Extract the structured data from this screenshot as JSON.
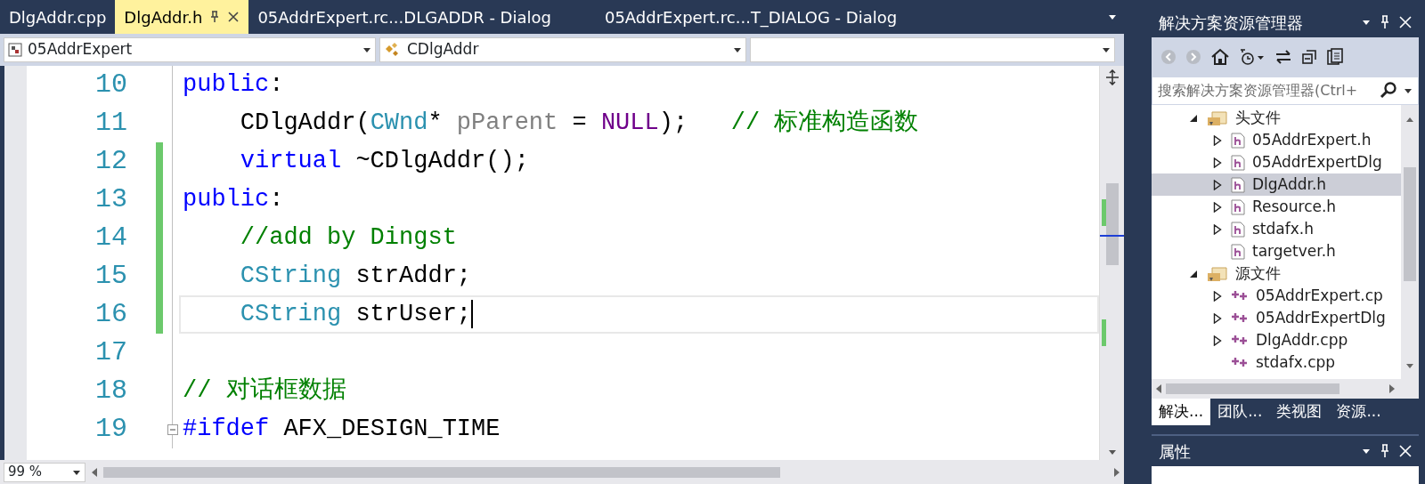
{
  "editor_tabs": [
    {
      "label": "DlgAddr.cpp",
      "selected": false,
      "pinned": false
    },
    {
      "label": "DlgAddr.h",
      "selected": true,
      "pinned": true
    },
    {
      "label": "05AddrExpert.rc...DLGADDR - Dialog",
      "selected": false,
      "pinned": false
    },
    {
      "label": "05AddrExpert.rc...T_DIALOG - Dialog",
      "selected": false,
      "pinned": false
    }
  ],
  "nav_bar": {
    "project": "05AddrExpert",
    "class": "CDlgAddr"
  },
  "code": {
    "lines": [
      {
        "number": "10",
        "indented": false,
        "modified": false,
        "current": false,
        "tokens": [
          {
            "kind": "keyword",
            "text": "public"
          },
          {
            "kind": "plain",
            "text": ":"
          }
        ]
      },
      {
        "number": "11",
        "indented": true,
        "modified": false,
        "current": false,
        "tokens": [
          {
            "kind": "plain",
            "text": "CDlgAddr("
          },
          {
            "kind": "type",
            "text": "CWnd"
          },
          {
            "kind": "plain",
            "text": "* "
          },
          {
            "kind": "param",
            "text": "pParent"
          },
          {
            "kind": "plain",
            "text": " = "
          },
          {
            "kind": "macro",
            "text": "NULL"
          },
          {
            "kind": "plain",
            "text": ");   "
          },
          {
            "kind": "comment",
            "text": "// 标准构造函数"
          }
        ]
      },
      {
        "number": "12",
        "indented": true,
        "modified": true,
        "current": false,
        "tokens": [
          {
            "kind": "keyword",
            "text": "virtual"
          },
          {
            "kind": "plain",
            "text": " ~CDlgAddr();"
          }
        ]
      },
      {
        "number": "13",
        "indented": false,
        "modified": true,
        "current": false,
        "tokens": [
          {
            "kind": "keyword",
            "text": "public"
          },
          {
            "kind": "plain",
            "text": ":"
          }
        ]
      },
      {
        "number": "14",
        "indented": true,
        "modified": true,
        "current": false,
        "tokens": [
          {
            "kind": "comment",
            "text": "//add by Dingst"
          }
        ]
      },
      {
        "number": "15",
        "indented": true,
        "modified": true,
        "current": false,
        "tokens": [
          {
            "kind": "type",
            "text": "CString"
          },
          {
            "kind": "plain",
            "text": " strAddr;"
          }
        ]
      },
      {
        "number": "16",
        "indented": true,
        "modified": true,
        "current": true,
        "tokens": [
          {
            "kind": "type",
            "text": "CString"
          },
          {
            "kind": "plain",
            "text": " strUser;"
          }
        ]
      },
      {
        "number": "17",
        "modified": false,
        "current": false
      },
      {
        "number": "18",
        "indented": false,
        "modified": false,
        "current": false,
        "tokens": [
          {
            "kind": "comment",
            "text": "// 对话框数据"
          }
        ]
      },
      {
        "number": "19",
        "indented": false,
        "modified": false,
        "current": false,
        "fold_box": true,
        "tokens": [
          {
            "kind": "keyword",
            "text": "#ifdef"
          },
          {
            "kind": "plain",
            "text": " AFX_DESIGN_TIME"
          }
        ]
      }
    ]
  },
  "zoom": "99 %",
  "solution_explorer": {
    "title": "解决方案资源管理器",
    "search": {
      "placeholder": "搜索解决方案资源管理器(Ctrl+"
    },
    "tree": [
      {
        "label": "头文件",
        "kind": "folder",
        "expandable": true,
        "expanded": true,
        "selected": false,
        "children": [
          {
            "label": "05AddrExpert.h",
            "kind": "header",
            "expandable": true,
            "expanded": false,
            "selected": false
          },
          {
            "label": "05AddrExpertDlg",
            "kind": "header",
            "expandable": true,
            "expanded": false,
            "selected": false
          },
          {
            "label": "DlgAddr.h",
            "kind": "header",
            "expandable": true,
            "expanded": false,
            "selected": true
          },
          {
            "label": "Resource.h",
            "kind": "header",
            "expandable": true,
            "expanded": false,
            "selected": false
          },
          {
            "label": "stdafx.h",
            "kind": "header",
            "expandable": true,
            "expanded": false,
            "selected": false
          },
          {
            "label": "targetver.h",
            "kind": "header",
            "expandable": false,
            "expanded": false,
            "selected": false
          }
        ]
      },
      {
        "label": "源文件",
        "kind": "folder",
        "expandable": true,
        "expanded": true,
        "selected": false,
        "children": [
          {
            "label": "05AddrExpert.cp",
            "kind": "source",
            "expandable": true,
            "expanded": false,
            "selected": false
          },
          {
            "label": "05AddrExpertDlg",
            "kind": "source",
            "expandable": true,
            "expanded": false,
            "selected": false
          },
          {
            "label": "DlgAddr.cpp",
            "kind": "source",
            "expandable": true,
            "expanded": false,
            "selected": false
          },
          {
            "label": "stdafx.cpp",
            "kind": "source",
            "expandable": false,
            "expanded": false,
            "selected": false
          }
        ]
      }
    ],
    "bottom_tabs": [
      {
        "label": "解决...",
        "selected": true
      },
      {
        "label": "团队...",
        "selected": false
      },
      {
        "label": "类视图",
        "selected": false
      },
      {
        "label": "资源...",
        "selected": false
      }
    ]
  },
  "properties": {
    "title": "属性"
  }
}
